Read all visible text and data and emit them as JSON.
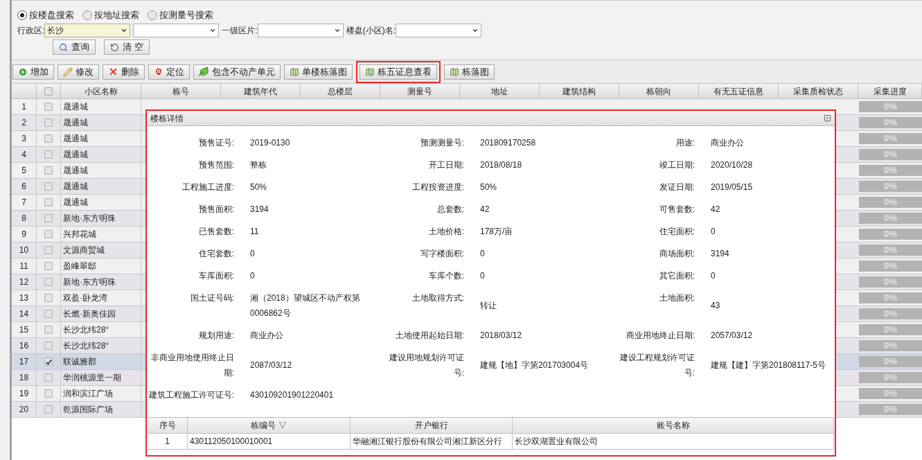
{
  "search": {
    "modes": [
      {
        "label": "按楼盘搜索",
        "selected": true
      },
      {
        "label": "按地址搜索",
        "selected": false
      },
      {
        "label": "按测量号搜索",
        "selected": false
      }
    ],
    "filters": [
      {
        "kind": "select",
        "label": "行政区:",
        "value": "长沙"
      },
      {
        "kind": "select"
      },
      {
        "kind": "select",
        "label": "一级区片:"
      },
      {
        "kind": "select",
        "label": "楼盘(小区)名:"
      }
    ],
    "buttons": [
      {
        "kind": "search",
        "label": "查询"
      },
      {
        "kind": "clear",
        "label": "清 空"
      }
    ]
  },
  "toolbar": [
    {
      "kind": "add",
      "label": "增加",
      "highlighted": false
    },
    {
      "kind": "edit",
      "label": "修改",
      "highlighted": false
    },
    {
      "kind": "delete",
      "label": "删除",
      "highlighted": false
    },
    {
      "kind": "locate",
      "label": "定位",
      "highlighted": false
    },
    {
      "kind": "include",
      "label": "包含不动产单元",
      "highlighted": false
    },
    {
      "kind": "map",
      "label": "单楼栋落图",
      "highlighted": false
    },
    {
      "kind": "map",
      "label": "栋五证息查看",
      "highlighted": true
    },
    {
      "kind": "map",
      "label": "栋落图",
      "highlighted": false
    }
  ],
  "grid": {
    "all_checked": false,
    "columns": [
      "小区名称",
      "栋号",
      "建筑年代",
      "总楼层",
      "测量号",
      "地址",
      "建筑结构",
      "栋朝向",
      "有无五证信息",
      "采集质检状态",
      "采集进度"
    ],
    "rows": [
      {
        "index": "1",
        "checked": false,
        "selected": false,
        "name": "晟通城",
        "progress": "0%"
      },
      {
        "index": "2",
        "checked": false,
        "selected": false,
        "name": "晟通城",
        "progress": "0%"
      },
      {
        "index": "3",
        "checked": false,
        "selected": false,
        "name": "晟通城",
        "progress": "0%"
      },
      {
        "index": "4",
        "checked": false,
        "selected": false,
        "name": "晟通城",
        "progress": "0%"
      },
      {
        "index": "5",
        "checked": false,
        "selected": false,
        "name": "晟通城",
        "progress": "0%"
      },
      {
        "index": "6",
        "checked": false,
        "selected": false,
        "name": "晟通城",
        "progress": "0%"
      },
      {
        "index": "7",
        "checked": false,
        "selected": false,
        "name": "晟通城",
        "progress": "0%"
      },
      {
        "index": "8",
        "checked": false,
        "selected": false,
        "name": "新地·东方明珠",
        "progress": "0%"
      },
      {
        "index": "9",
        "checked": false,
        "selected": false,
        "name": "兴邦花城",
        "progress": "0%"
      },
      {
        "index": "10",
        "checked": false,
        "selected": false,
        "name": "文源商贸城",
        "progress": "0%"
      },
      {
        "index": "11",
        "checked": false,
        "selected": false,
        "name": "盈峰翠邸",
        "progress": "0%"
      },
      {
        "index": "12",
        "checked": false,
        "selected": false,
        "name": "新地·东方明珠",
        "progress": "0%"
      },
      {
        "index": "13",
        "checked": false,
        "selected": false,
        "name": "双盈·卧龙湾",
        "progress": "0%"
      },
      {
        "index": "14",
        "checked": false,
        "selected": false,
        "name": "长燃·新奥佳园",
        "progress": "0%"
      },
      {
        "index": "15",
        "checked": false,
        "selected": false,
        "name": "长沙北纬28°",
        "progress": "0%"
      },
      {
        "index": "16",
        "checked": false,
        "selected": false,
        "name": "长沙北纬28°",
        "progress": "0%"
      },
      {
        "index": "17",
        "checked": true,
        "selected": true,
        "name": "联诚雅郡",
        "progress": "0%"
      },
      {
        "index": "18",
        "checked": false,
        "selected": false,
        "name": "华润桃源里一期",
        "progress": "0%"
      },
      {
        "index": "19",
        "checked": false,
        "selected": false,
        "name": "润和滨江广场",
        "progress": "0%"
      },
      {
        "index": "20",
        "checked": false,
        "selected": false,
        "name": "乾源国际广场",
        "progress": "0%"
      }
    ]
  },
  "dialog": {
    "title": "楼栋详情",
    "highlighted": true,
    "fields": [
      {
        "label": "预售证号:",
        "value": "2019-0130"
      },
      {
        "label": "预测测量号:",
        "value": "201809170258"
      },
      {
        "label": "用途:",
        "value": "商业办公"
      },
      {
        "label": "预售范围:",
        "value": "整栋"
      },
      {
        "label": "开工日期:",
        "value": "2018/08/18"
      },
      {
        "label": "竣工日期:",
        "value": "2020/10/28"
      },
      {
        "label": "工程施工进度:",
        "value": "50%"
      },
      {
        "label": "工程投资进度:",
        "value": "50%"
      },
      {
        "label": "发证日期:",
        "value": "2019/05/15"
      },
      {
        "label": "预售面积:",
        "value": "3194"
      },
      {
        "label": "总套数:",
        "value": "42"
      },
      {
        "label": "可售套数:",
        "value": "42"
      },
      {
        "label": "已售套数:",
        "value": "11"
      },
      {
        "label": "土地价格:",
        "value": "178万/亩"
      },
      {
        "label": "住宅面积:",
        "value": "0"
      },
      {
        "label": "住宅套数:",
        "value": "0"
      },
      {
        "label": "写字楼面积:",
        "value": "0"
      },
      {
        "label": "商场面积:",
        "value": "3194"
      },
      {
        "label": "车库面积:",
        "value": "0"
      },
      {
        "label": "车库个数:",
        "value": "0"
      },
      {
        "label": "其它面积:",
        "value": "0"
      },
      {
        "label": "国土证号码:",
        "value": "湘（2018）望城区不动产权第0006862号"
      },
      {
        "label": "土地取得方式:",
        "value": "转让"
      },
      {
        "label": "土地面积:",
        "value": "43"
      },
      {
        "label": "规划用途:",
        "value": "商业办公"
      },
      {
        "label": "土地使用起始日期:",
        "value": "2018/03/12"
      },
      {
        "label": "商业用地终止日期:",
        "value": "2057/03/12"
      },
      {
        "label": "非商业用地使用终止日期:",
        "value": "2087/03/12"
      },
      {
        "label": "建设用地规划许可证号:",
        "value": "建规【地】字第201703004号"
      },
      {
        "label": "建设工程规划许可证号:",
        "value": "建规【建】字第201808117-5号"
      },
      {
        "label": "建筑工程施工许可证号:",
        "value": "430109201901220401"
      }
    ],
    "accounts": {
      "columns": [
        "序号",
        "栋编号 ▽",
        "开户银行",
        "账号名称"
      ],
      "rows": [
        [
          "1",
          "430112050100010001",
          "华融湘江银行股份有限公司湘江新区分行",
          "长沙双湖置业有限公司"
        ]
      ]
    }
  }
}
